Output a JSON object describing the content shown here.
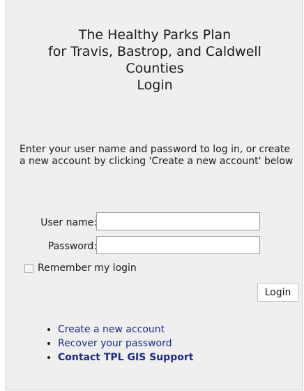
{
  "header": {
    "title_lines": [
      "The Healthy Parks Plan",
      "for Travis, Bastrop, and Caldwell",
      "Counties",
      "Login"
    ]
  },
  "instructions": "Enter your user name and password to log in, or create a new account by clicking 'Create a new account' below",
  "form": {
    "username_label": "User name:",
    "username_value": "",
    "password_label": "Password:",
    "password_value": "",
    "remember_label": "Remember my login",
    "remember_checked": false,
    "login_button": "Login"
  },
  "links": [
    {
      "label": "Create a new account",
      "bold": false
    },
    {
      "label": "Recover your password",
      "bold": false
    },
    {
      "label": "Contact TPL GIS Support",
      "bold": true
    }
  ],
  "colors": {
    "panel_background": "#efefef",
    "link": "#1d2a8c"
  }
}
